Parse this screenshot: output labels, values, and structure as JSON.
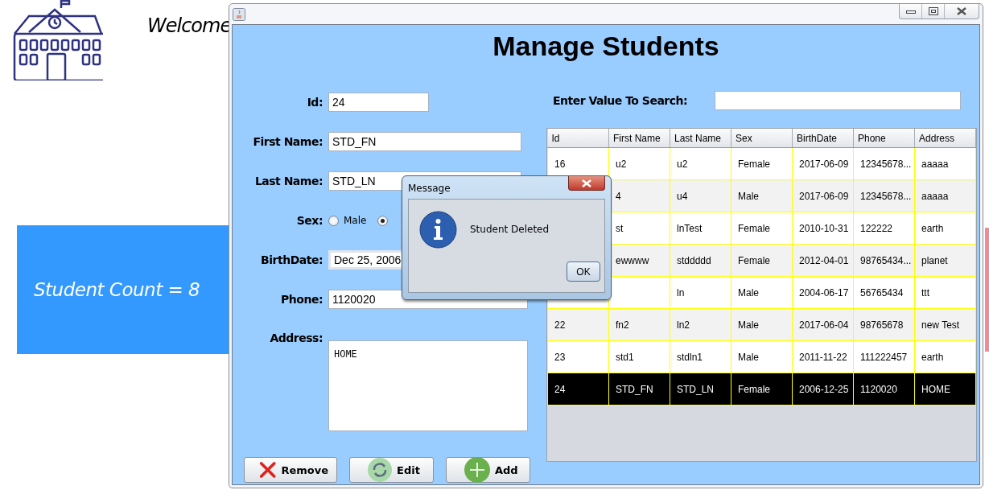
{
  "background": {
    "welcome": "Welcome",
    "student_count": "Student Count = 8"
  },
  "window": {
    "heading": "Manage Students",
    "form": {
      "fields": [
        {
          "label": "Id:",
          "value": "24",
          "kind": "short"
        },
        {
          "label": "First Name:",
          "value": "STD_FN",
          "kind": "text"
        },
        {
          "label": "Last Name:",
          "value": "STD_LN",
          "kind": "text"
        },
        {
          "label": "Sex:",
          "kind": "radio",
          "options": [
            {
              "label": "Male",
              "selected": false
            },
            {
              "selected": true
            }
          ]
        },
        {
          "label": "BirthDate:",
          "value": "Dec 25, 2006",
          "kind": "date"
        },
        {
          "label": "Phone:",
          "value": "1120020",
          "kind": "text"
        },
        {
          "label": "Address:",
          "value": "HOME",
          "kind": "area"
        }
      ]
    },
    "search": {
      "label": "Enter Value To Search:"
    },
    "table": {
      "columns": [
        "Id",
        "First Name",
        "Last Name",
        "Sex",
        "BirthDate",
        "Phone",
        "Address"
      ],
      "rows": [
        {
          "selected": false,
          "cells": [
            "16",
            "u2",
            "u2",
            "Female",
            "2017-06-09",
            "12345678...",
            "aaaaa"
          ]
        },
        {
          "selected": false,
          "cells": [
            null,
            "4",
            "u4",
            "Male",
            "2017-06-09",
            "12345678...",
            "aaaaa"
          ]
        },
        {
          "selected": false,
          "cells": [
            null,
            "st",
            "lnTest",
            "Female",
            "2010-10-31",
            "122222",
            "earth"
          ]
        },
        {
          "selected": false,
          "cells": [
            null,
            "ewwww",
            "stddddd",
            "Female",
            "2012-04-01",
            "98765434...",
            "planet"
          ]
        },
        {
          "selected": false,
          "cells": [
            null,
            null,
            "ln",
            "Male",
            "2004-06-17",
            "56765434",
            "ttt"
          ]
        },
        {
          "selected": false,
          "cells": [
            "22",
            "fn2",
            "ln2",
            "Male",
            "2017-06-04",
            "98765678",
            "new Test"
          ]
        },
        {
          "selected": false,
          "cells": [
            "23",
            "std1",
            "stdln1",
            "Male",
            "2011-11-22",
            "111222457",
            "earth"
          ]
        },
        {
          "selected": true,
          "cells": [
            "24",
            "STD_FN",
            "STD_LN",
            "Female",
            "2006-12-25",
            "1120020",
            "HOME"
          ]
        }
      ]
    },
    "buttons": [
      {
        "label": "Remove",
        "kind": "remove"
      },
      {
        "label": "Edit",
        "kind": "edit"
      },
      {
        "label": "Add",
        "kind": "add"
      }
    ]
  },
  "dialog": {
    "title": "Message",
    "message": "Student Deleted",
    "button": "OK"
  }
}
